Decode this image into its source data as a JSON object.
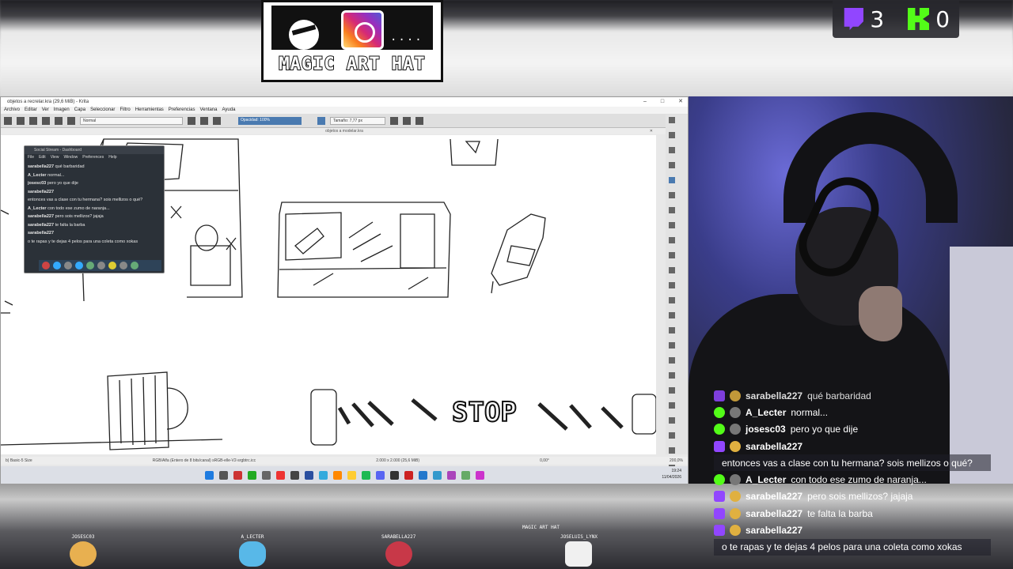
{
  "logo": {
    "text": "MAGIC ART HAT",
    "dots": "...."
  },
  "counters": {
    "twitch": "3",
    "kick": "0"
  },
  "krita": {
    "window_title": "objetos a recrelar.kra (29,6 MiB) - Krita",
    "menu": [
      "Archivo",
      "Editar",
      "Ver",
      "Imagen",
      "Capa",
      "Seleccionar",
      "Filtro",
      "Herramientas",
      "Preferencias",
      "Ventana",
      "Ayuda"
    ],
    "blend_mode": "Normal",
    "opacity": "Opacidad: 100%",
    "size": "Tamaño: 7,77 px",
    "doc_tab": "objetos a modelar.kra",
    "status_left": "b) Basic-5 Size",
    "status_mid": "RGB/Alfa (Entero de 8 bits/canal) sRGB-elle-V2-srgbtrc.icc",
    "status_right": "2.000 x 2.000 (25,6 MiB)",
    "zoom": "200,0%",
    "rotation": "0,00°",
    "clock_time": "19:24",
    "clock_date": "11/04/2026",
    "sketch_text": "STOP"
  },
  "chat_popup": {
    "title": "Social Stream - Dashboard",
    "menu": [
      "File",
      "Edit",
      "View",
      "Window",
      "Preferences",
      "Help"
    ],
    "lines": [
      {
        "user": "sarabella227",
        "msg": "qué barbaridad"
      },
      {
        "user": "A_Lecter",
        "msg": "normal..."
      },
      {
        "user": "josesc03",
        "msg": "pero yo que dije"
      },
      {
        "user": "sarabella227",
        "msg": ""
      },
      {
        "user": "",
        "msg": "entonces vas a clase con tu hermana? sois mellizos o qué?"
      },
      {
        "user": "A_Lecter",
        "msg": "con todo ese zumo de naranja..."
      },
      {
        "user": "sarabella227",
        "msg": "pero sois mellizos? jajaja"
      },
      {
        "user": "sarabella227",
        "msg": "te falta la barba"
      },
      {
        "user": "sarabella227",
        "msg": ""
      },
      {
        "user": "",
        "msg": "o te rapas y te dejas 4 pelos para una coleta como xokas"
      }
    ]
  },
  "overlay_chat": [
    {
      "platform": "twitch",
      "user": "sarabella227",
      "msg": "qué barbaridad"
    },
    {
      "platform": "kick",
      "user": "A_Lecter",
      "msg": "normal..."
    },
    {
      "platform": "kick",
      "user": "josesc03",
      "msg": "pero yo que dije"
    },
    {
      "platform": "twitch",
      "user": "sarabella227",
      "msg": ""
    },
    {
      "platform": "",
      "user": "",
      "msg": "entonces vas a clase con tu hermana? sois mellizos o qué?"
    },
    {
      "platform": "kick",
      "user": "A_Lecter",
      "msg": "con todo ese zumo de naranja..."
    },
    {
      "platform": "twitch",
      "user": "sarabella227",
      "msg": "pero sois mellizos? jajaja"
    },
    {
      "platform": "twitch",
      "user": "sarabella227",
      "msg": "te falta la barba"
    },
    {
      "platform": "twitch",
      "user": "sarabella227",
      "msg": ""
    },
    {
      "platform": "",
      "user": "",
      "msg": "o te rapas y te dejas 4 pelos para una coleta como xokas"
    }
  ],
  "avatars": [
    "JOSESC03",
    "A_LECTER",
    "SARABELLA227",
    "MAGIC ART HAT",
    "JOSELUIS_LYNX"
  ],
  "colors": {
    "twitch": "#9146ff",
    "kick": "#53fc18",
    "krita_accent": "#4a7ab0"
  }
}
